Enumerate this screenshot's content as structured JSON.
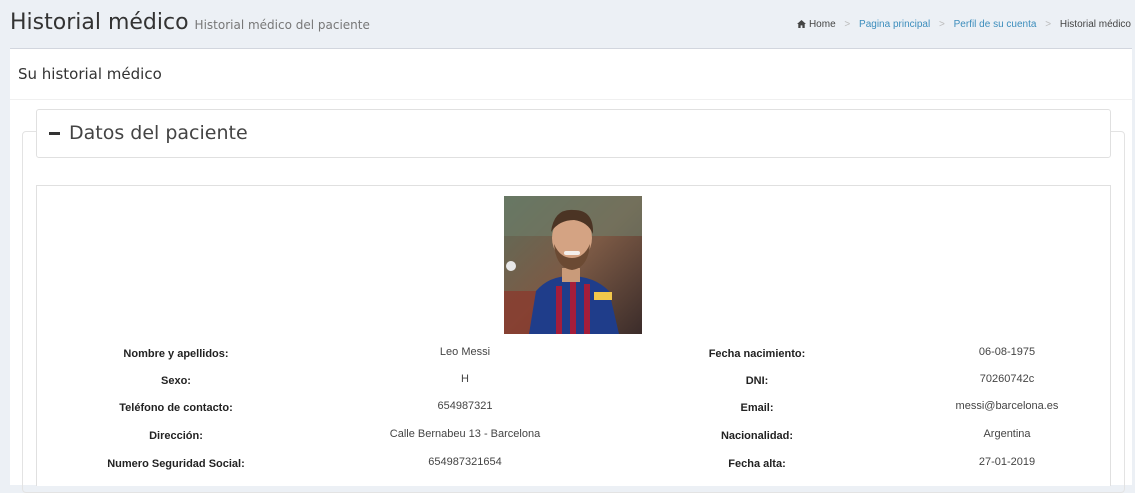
{
  "header": {
    "title": "Historial médico",
    "subtitle": "Historial médico del paciente",
    "breadcrumb": [
      {
        "label": "Home",
        "icon": "home-icon"
      },
      {
        "label": "Pagina principal"
      },
      {
        "label": "Perfil de su cuenta"
      },
      {
        "label": "Historial médico"
      }
    ]
  },
  "box": {
    "title": "Su historial médico",
    "section_title": "Datos del paciente"
  },
  "patient": {
    "photo_alt": "Leo Messi",
    "rows": [
      {
        "label1": "Nombre y apellidos:",
        "value1": "Leo Messi",
        "label2": "Fecha nacimiento:",
        "value2": "06-08-1975"
      },
      {
        "label1": "Sexo:",
        "value1": "H",
        "label2": "DNI:",
        "value2": "70260742c"
      },
      {
        "label1": "Teléfono de contacto:",
        "value1": "654987321",
        "label2": "Email:",
        "value2": "messi@barcelona.es"
      },
      {
        "label1": "Dirección:",
        "value1": "Calle Bernabeu 13 - Barcelona",
        "label2": "Nacionalidad:",
        "value2": "Argentina"
      },
      {
        "label1": "Numero Seguridad Social:",
        "value1": "654987321654",
        "label2": "Fecha alta:",
        "value2": "27-01-2019"
      }
    ]
  },
  "colors": {
    "link": "#3c8dbc",
    "background": "#ecf0f5",
    "jersey": "#1f3d8a"
  }
}
